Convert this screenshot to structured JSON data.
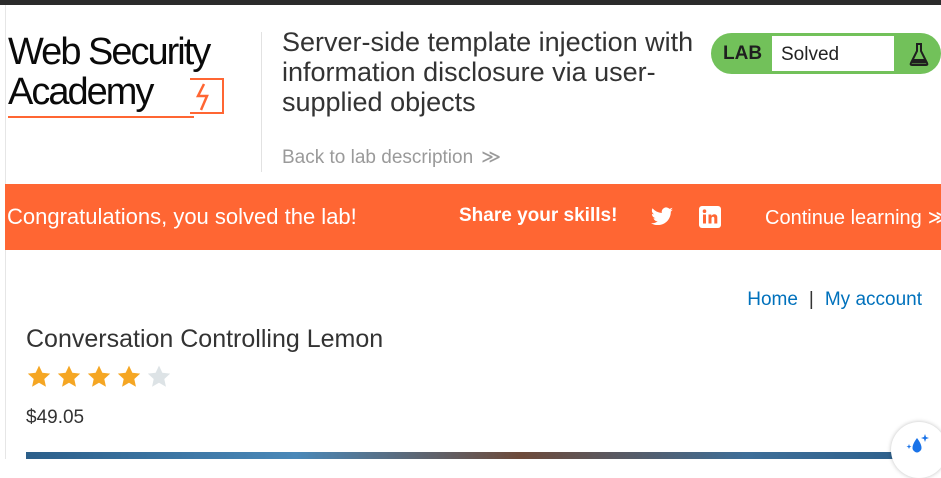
{
  "logo": {
    "line1": "Web Security",
    "line2": "Academy"
  },
  "header": {
    "title": "Server-side template injection with information disclosure via user-supplied objects",
    "back_link": "Back to lab description",
    "back_chevrons": "≫"
  },
  "lab_status": {
    "tag": "LAB",
    "status": "Solved",
    "icon": "flask-icon"
  },
  "banner": {
    "message": "Congratulations, you solved the lab!",
    "share_label": "Share your skills!",
    "twitter_icon": "twitter-icon",
    "linkedin_icon": "linkedin-icon",
    "continue_label": "Continue learning",
    "continue_chevrons": "≫",
    "color": "#ff6633"
  },
  "nav": {
    "home": "Home",
    "separator": "|",
    "account": "My account"
  },
  "product": {
    "name": "Conversation Controlling Lemon",
    "rating": 4,
    "rating_max": 5,
    "price": "$49.05"
  },
  "colors": {
    "accent": "#ff6633",
    "lab_green": "#72c15a",
    "link": "#0071bc",
    "star": "#f5a623",
    "star_empty": "#dde3e6"
  }
}
